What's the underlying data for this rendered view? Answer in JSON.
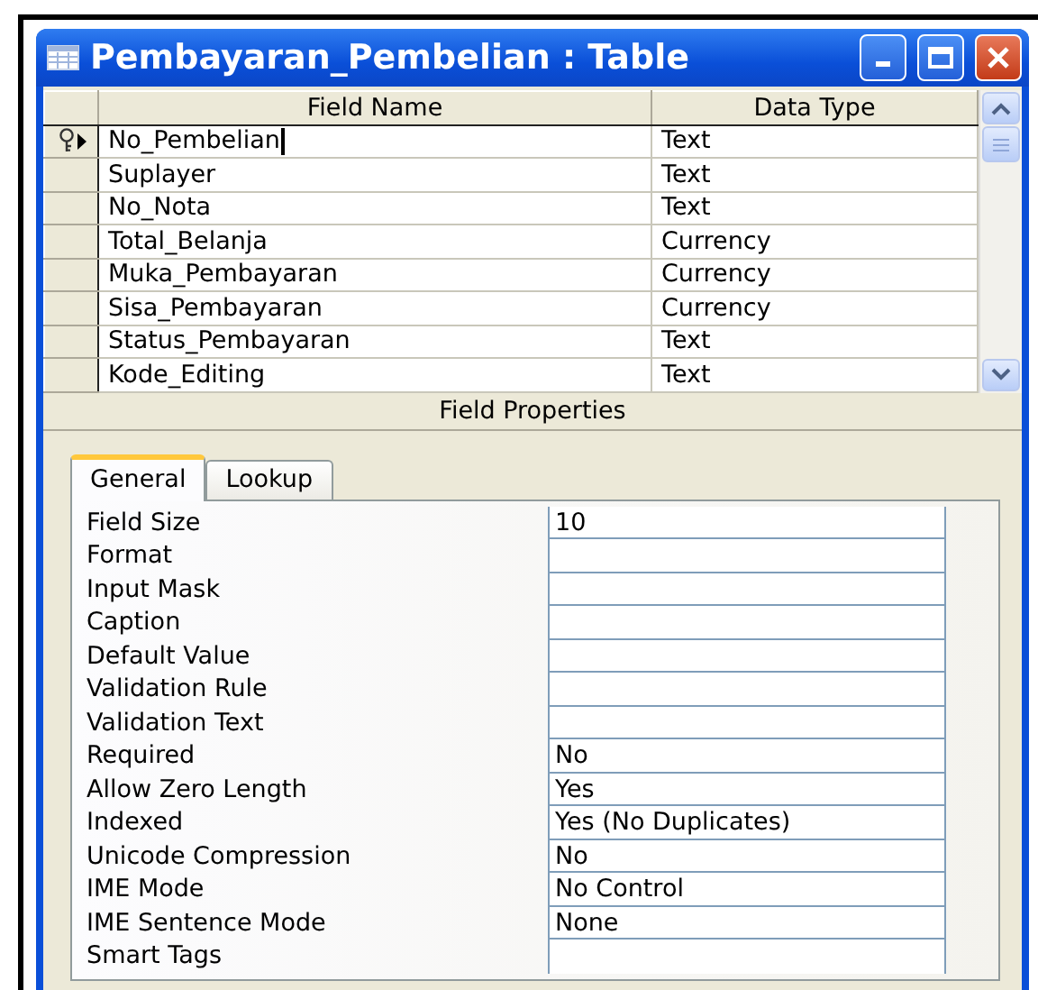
{
  "window": {
    "title": "Pembayaran_Pembelian : Table"
  },
  "grid": {
    "columns": [
      "Field Name",
      "Data Type"
    ],
    "rows": [
      {
        "field_name": "No_Pembelian",
        "data_type": "Text",
        "primary_key": true,
        "selected": true
      },
      {
        "field_name": "Suplayer",
        "data_type": "Text",
        "primary_key": false,
        "selected": false
      },
      {
        "field_name": "No_Nota",
        "data_type": "Text",
        "primary_key": false,
        "selected": false
      },
      {
        "field_name": "Total_Belanja",
        "data_type": "Currency",
        "primary_key": false,
        "selected": false
      },
      {
        "field_name": "Muka_Pembayaran",
        "data_type": "Currency",
        "primary_key": false,
        "selected": false
      },
      {
        "field_name": "Sisa_Pembayaran",
        "data_type": "Currency",
        "primary_key": false,
        "selected": false
      },
      {
        "field_name": "Status_Pembayaran",
        "data_type": "Text",
        "primary_key": false,
        "selected": false
      },
      {
        "field_name": "Kode_Editing",
        "data_type": "Text",
        "primary_key": false,
        "selected": false
      }
    ]
  },
  "field_properties": {
    "title": "Field Properties",
    "tabs": [
      {
        "label": "General",
        "selected": true
      },
      {
        "label": "Lookup",
        "selected": false
      }
    ],
    "properties": [
      {
        "label": "Field Size",
        "value": "10"
      },
      {
        "label": "Format"
      },
      {
        "label": "Input Mask"
      },
      {
        "label": "Caption"
      },
      {
        "label": "Default Value"
      },
      {
        "label": "Validation Rule"
      },
      {
        "label": "Validation Text"
      },
      {
        "label": "Required",
        "value": "No"
      },
      {
        "label": "Allow Zero Length",
        "value": "Yes"
      },
      {
        "label": "Indexed",
        "value": "Yes (No Duplicates)"
      },
      {
        "label": "Unicode Compression",
        "value": "No"
      },
      {
        "label": "IME Mode",
        "value": "No Control"
      },
      {
        "label": "IME Sentence Mode",
        "value": "None"
      },
      {
        "label": "Smart Tags"
      }
    ]
  }
}
